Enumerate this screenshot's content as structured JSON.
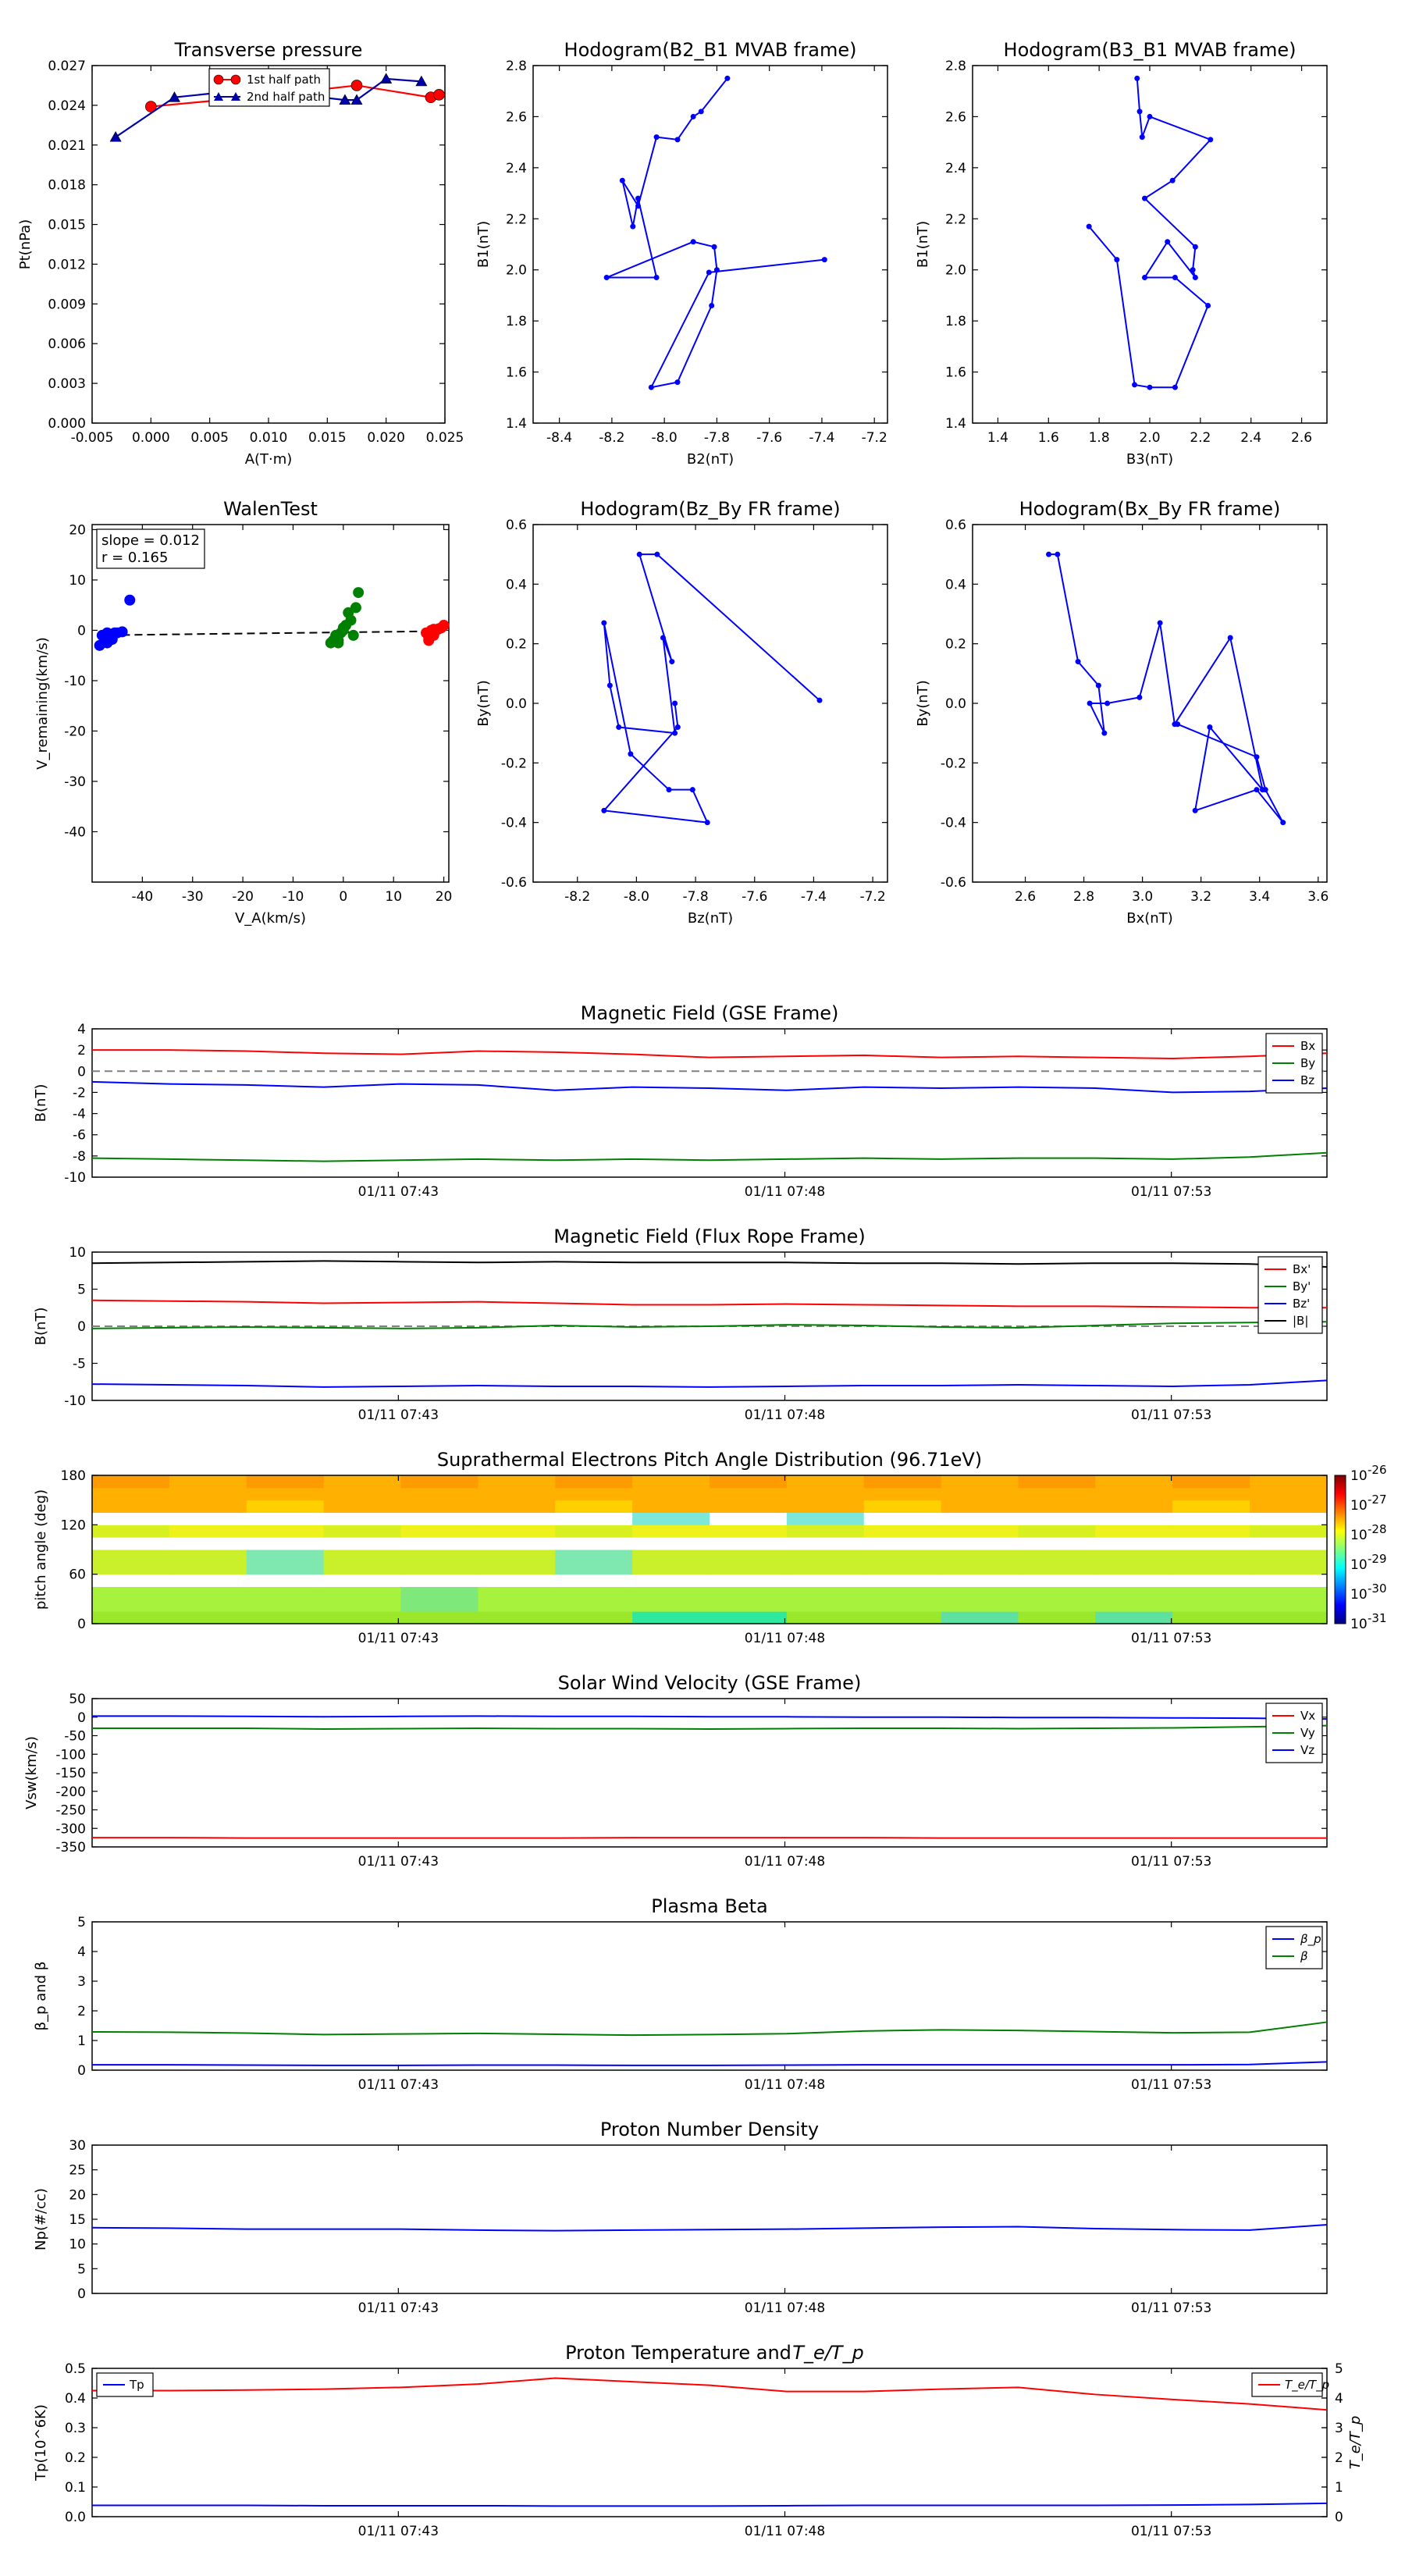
{
  "colors": {
    "red": "#ff0000",
    "green": "#008000",
    "blue": "#0000ff",
    "black": "#000000",
    "grey": "#808080"
  },
  "time_ticks": [
    "01/11 07:43",
    "01/11 07:48",
    "01/11 07:53"
  ],
  "chart_data": [
    {
      "id": "tp",
      "type": "line",
      "title": "Transverse pressure",
      "xlabel": "A(T·m)",
      "ylabel": "Pt(nPa)",
      "xlim": [
        -0.005,
        0.025
      ],
      "ylim": [
        0.0,
        0.027
      ],
      "xticks": [
        "-0.005",
        "0.000",
        "0.005",
        "0.010",
        "0.015",
        "0.020",
        "0.025"
      ],
      "yticks": [
        "0.000",
        "0.003",
        "0.006",
        "0.009",
        "0.012",
        "0.015",
        "0.018",
        "0.021",
        "0.024",
        "0.027"
      ],
      "legend": "top-center",
      "series": [
        {
          "name": "1st half path",
          "marker": "circle",
          "color": "#ff0000",
          "x": [
            0.0,
            0.0095,
            0.0175,
            0.0238,
            0.0245
          ],
          "y": [
            0.0239,
            0.0247,
            0.0255,
            0.0246,
            0.0248
          ]
        },
        {
          "name": "2nd half path",
          "marker": "triangle",
          "color": "#0000ab",
          "x": [
            -0.003,
            0.002,
            0.0085,
            0.0165,
            0.0175,
            0.02,
            0.023
          ],
          "y": [
            0.0216,
            0.0246,
            0.0252,
            0.0244,
            0.0244,
            0.026,
            0.0258
          ]
        }
      ]
    },
    {
      "id": "h21",
      "type": "line",
      "title": "Hodogram(B2_B1 MVAB frame)",
      "xlabel": "B2(nT)",
      "ylabel": "B1(nT)",
      "xlim": [
        -8.5,
        -7.15
      ],
      "ylim": [
        1.4,
        2.8
      ],
      "xticks": [
        "-8.4",
        "-8.2",
        "-8.0",
        "-7.8",
        "-7.6",
        "-7.4",
        "-7.2"
      ],
      "yticks": [
        "1.4",
        "1.6",
        "1.8",
        "2.0",
        "2.2",
        "2.4",
        "2.6",
        "2.8"
      ],
      "series": [
        {
          "name": "",
          "x": [
            -7.76,
            -7.86,
            -7.89,
            -7.95,
            -8.03,
            -8.1,
            -8.16,
            -8.12,
            -8.1,
            -8.03,
            -8.22,
            -7.89,
            -7.81,
            -7.8,
            -7.82,
            -7.95,
            -8.05,
            -7.83,
            -7.39
          ],
          "y": [
            2.75,
            2.62,
            2.6,
            2.51,
            2.52,
            2.25,
            2.35,
            2.17,
            2.28,
            1.97,
            1.97,
            2.11,
            2.09,
            2.0,
            1.86,
            1.56,
            1.54,
            1.99,
            2.04
          ]
        }
      ]
    },
    {
      "id": "h31",
      "type": "line",
      "title": "Hodogram(B3_B1 MVAB frame)",
      "xlabel": "B3(nT)",
      "ylabel": "B1(nT)",
      "xlim": [
        1.3,
        2.7
      ],
      "ylim": [
        1.4,
        2.8
      ],
      "xticks": [
        "1.4",
        "1.6",
        "1.8",
        "2.0",
        "2.2",
        "2.4",
        "2.6"
      ],
      "yticks": [
        "1.4",
        "1.6",
        "1.8",
        "2.0",
        "2.2",
        "2.4",
        "2.6",
        "2.8"
      ],
      "series": [
        {
          "name": "",
          "x": [
            1.95,
            1.96,
            1.97,
            2.0,
            2.24,
            2.09,
            1.98,
            2.18,
            2.17,
            2.18,
            2.07,
            1.98,
            2.1,
            2.23,
            2.1,
            2.0,
            1.94,
            1.87,
            1.76
          ],
          "y": [
            2.75,
            2.62,
            2.52,
            2.6,
            2.51,
            2.35,
            2.28,
            2.09,
            2.0,
            1.97,
            2.11,
            1.97,
            1.97,
            1.86,
            1.54,
            1.54,
            1.55,
            2.04,
            2.17
          ]
        }
      ]
    },
    {
      "id": "walen",
      "type": "scatter",
      "title": "WalenTest",
      "xlabel": "V_A(km/s)",
      "ylabel": "V_remaining(km/s)",
      "xlim": [
        -50,
        21
      ],
      "ylim": [
        -50,
        21
      ],
      "xticks": [
        "-40",
        "-30",
        "-20",
        "-10",
        "0",
        "10",
        "20"
      ],
      "yticks": [
        "-40",
        "-30",
        "-20",
        "-10",
        "0",
        "10",
        "20"
      ],
      "annotation": [
        "slope = 0.012",
        "r = 0.165"
      ],
      "fit": {
        "slope": 0.012,
        "intercept": -0.4,
        "x": [
          -49,
          20
        ]
      },
      "series": [
        {
          "name": "",
          "color": "#0000ff",
          "x": [
            -48,
            -47.5,
            -47,
            -46.5,
            -46,
            -45.5,
            -45,
            -44,
            -42.5,
            -48.5,
            -47,
            -46
          ],
          "y": [
            -1.0,
            -2.0,
            -0.5,
            -1.5,
            -0.8,
            -0.5,
            -0.5,
            -0.3,
            6.0,
            -3.0,
            -2.5,
            -1.8
          ]
        },
        {
          "name": "",
          "color": "#008000",
          "x": [
            -2.5,
            -2.0,
            -1.5,
            -1.0,
            -0.5,
            0.0,
            0.5,
            1.0,
            1.5,
            2.0,
            2.5,
            3.0,
            -1.0,
            0.0
          ],
          "y": [
            -2.5,
            -2.0,
            -1.0,
            -2.0,
            -0.5,
            0.5,
            1.0,
            3.5,
            2.0,
            -1.0,
            4.5,
            7.5,
            -2.5,
            0.0
          ]
        },
        {
          "name": "",
          "color": "#ff0000",
          "x": [
            16.5,
            17.0,
            17.5,
            18.0,
            18.5,
            19.0,
            19.5,
            20.0,
            17.0,
            18.0
          ],
          "y": [
            -0.5,
            -1.5,
            0.0,
            -1.0,
            0.0,
            0.3,
            0.5,
            1.0,
            -2.0,
            0.2
          ]
        }
      ]
    },
    {
      "id": "hzy",
      "type": "line",
      "title": "Hodogram(Bz_By FR frame)",
      "xlabel": "Bz(nT)",
      "ylabel": "By(nT)",
      "xlim": [
        -8.35,
        -7.15
      ],
      "ylim": [
        -0.6,
        0.6
      ],
      "xticks": [
        "-8.2",
        "-8.0",
        "-7.8",
        "-7.6",
        "-7.4",
        "-7.2"
      ],
      "yticks": [
        "-0.6",
        "-0.4",
        "-0.2",
        "0.0",
        "0.2",
        "0.4",
        "0.6"
      ],
      "series": [
        {
          "name": "",
          "x": [
            -7.38,
            -7.93,
            -7.99,
            -7.88,
            -7.91,
            -7.87,
            -8.06,
            -8.09,
            -8.11,
            -8.02,
            -7.89,
            -7.81,
            -7.76,
            -8.11,
            -7.86,
            -7.87
          ],
          "y": [
            0.01,
            0.5,
            0.5,
            0.14,
            0.22,
            -0.1,
            -0.08,
            0.06,
            0.27,
            -0.17,
            -0.29,
            -0.29,
            -0.4,
            -0.36,
            -0.08,
            0.0
          ]
        }
      ]
    },
    {
      "id": "hxy",
      "type": "line",
      "title": "Hodogram(Bx_By FR frame)",
      "xlabel": "Bx(nT)",
      "ylabel": "By(nT)",
      "xlim": [
        2.42,
        3.63
      ],
      "ylim": [
        -0.6,
        0.6
      ],
      "xticks": [
        "2.6",
        "2.8",
        "3.0",
        "3.2",
        "3.4",
        "3.6"
      ],
      "yticks": [
        "-0.6",
        "-0.4",
        "-0.2",
        "0.0",
        "0.2",
        "0.4",
        "0.6"
      ],
      "series": [
        {
          "name": "",
          "x": [
            2.68,
            2.71,
            2.78,
            2.85,
            2.87,
            2.82,
            2.88,
            2.99,
            3.06,
            3.11,
            3.3,
            3.41,
            3.23,
            3.18,
            3.39,
            3.48,
            3.42,
            3.39,
            3.12
          ],
          "y": [
            0.5,
            0.5,
            0.14,
            0.06,
            -0.1,
            0.0,
            0.0,
            0.02,
            0.27,
            -0.07,
            0.22,
            -0.29,
            -0.08,
            -0.36,
            -0.29,
            -0.4,
            -0.29,
            -0.18,
            -0.07
          ]
        }
      ]
    },
    {
      "id": "mag_gse",
      "type": "line",
      "title": "Magnetic Field (GSE Frame)",
      "ylabel": "B(nT)",
      "ylim": [
        -10,
        4
      ],
      "yticks": [
        "-10",
        "-8",
        "-6",
        "-4",
        "-2",
        "0",
        "2",
        "4"
      ],
      "legend": "top-right",
      "hline": 0,
      "series": [
        {
          "name": "Bx",
          "color": "#ff0000",
          "values": [
            2.0,
            2.0,
            1.9,
            1.7,
            1.6,
            1.9,
            1.8,
            1.6,
            1.3,
            1.4,
            1.5,
            1.3,
            1.4,
            1.3,
            1.2,
            1.4,
            1.7
          ]
        },
        {
          "name": "By",
          "color": "#008000",
          "values": [
            -8.2,
            -8.3,
            -8.4,
            -8.5,
            -8.4,
            -8.3,
            -8.4,
            -8.3,
            -8.4,
            -8.3,
            -8.2,
            -8.3,
            -8.2,
            -8.2,
            -8.3,
            -8.1,
            -7.7
          ]
        },
        {
          "name": "Bz",
          "color": "#0000ff",
          "values": [
            -1.0,
            -1.2,
            -1.3,
            -1.5,
            -1.2,
            -1.3,
            -1.8,
            -1.5,
            -1.6,
            -1.8,
            -1.5,
            -1.6,
            -1.5,
            -1.6,
            -2.0,
            -1.9,
            -1.6
          ]
        }
      ]
    },
    {
      "id": "mag_fr",
      "type": "line",
      "title": "Magnetic Field (Flux Rope Frame)",
      "ylabel": "B(nT)",
      "ylim": [
        -10,
        10
      ],
      "yticks": [
        "-10",
        "-5",
        "0",
        "5",
        "10"
      ],
      "legend": "top-right",
      "hline": 0,
      "series": [
        {
          "name": "Bx'",
          "color": "#ff0000",
          "values": [
            3.5,
            3.4,
            3.3,
            3.1,
            3.2,
            3.3,
            3.1,
            2.9,
            2.9,
            3.0,
            2.9,
            2.8,
            2.7,
            2.7,
            2.6,
            2.5,
            2.5
          ]
        },
        {
          "name": "By'",
          "color": "#008000",
          "values": [
            -0.3,
            -0.2,
            -0.1,
            -0.2,
            -0.3,
            -0.2,
            0.1,
            -0.1,
            0.0,
            0.2,
            0.1,
            -0.1,
            -0.2,
            0.1,
            0.4,
            0.5,
            0.6
          ]
        },
        {
          "name": "Bz'",
          "color": "#0000ff",
          "values": [
            -7.8,
            -7.9,
            -8.0,
            -8.2,
            -8.1,
            -8.0,
            -8.1,
            -8.1,
            -8.2,
            -8.1,
            -8.0,
            -8.0,
            -7.9,
            -8.0,
            -8.1,
            -7.9,
            -7.3
          ]
        },
        {
          "name": "|B|",
          "color": "#000000",
          "values": [
            8.5,
            8.6,
            8.7,
            8.8,
            8.7,
            8.6,
            8.7,
            8.6,
            8.6,
            8.6,
            8.5,
            8.5,
            8.4,
            8.5,
            8.5,
            8.4,
            8.0
          ]
        }
      ]
    },
    {
      "id": "pad",
      "type": "heatmap",
      "title": "Suprathermal Electrons Pitch Angle Distribution (96.71eV)",
      "ylabel": "pitch angle (deg)",
      "ylim": [
        0,
        180
      ],
      "yticks": [
        "0",
        "60",
        "120",
        "180"
      ],
      "colorbar": {
        "ticks": [
          "10",
          "10",
          "10",
          "10",
          "10",
          "10"
        ],
        "exponents": [
          "-26",
          "-27",
          "-28",
          "-29",
          "-30",
          "-31"
        ]
      },
      "bins": [
        {
          "angle": [
            0,
            15
          ],
          "level": "green"
        },
        {
          "angle": [
            15,
            45
          ],
          "level": "lightgreen"
        },
        {
          "angle": [
            45,
            60
          ],
          "level": "white"
        },
        {
          "angle": [
            60,
            90
          ],
          "level": "yellowgreen"
        },
        {
          "angle": [
            90,
            105
          ],
          "level": "white"
        },
        {
          "angle": [
            105,
            120
          ],
          "level": "yellow"
        },
        {
          "angle": [
            120,
            135
          ],
          "level": "white"
        },
        {
          "angle": [
            135,
            150
          ],
          "level": "orange"
        },
        {
          "angle": [
            150,
            165
          ],
          "level": "orange"
        },
        {
          "angle": [
            165,
            180
          ],
          "level": "orange"
        }
      ]
    },
    {
      "id": "vsw",
      "type": "line",
      "title": "Solar Wind Velocity (GSE Frame)",
      "ylabel": "Vsw(km/s)",
      "ylim": [
        -350,
        50
      ],
      "yticks": [
        "-350",
        "-300",
        "-250",
        "-200",
        "-150",
        "-100",
        "-50",
        "0",
        "50"
      ],
      "legend": "top-right",
      "series": [
        {
          "name": "Vx",
          "color": "#ff0000",
          "values": [
            -325,
            -325,
            -326,
            -326,
            -326,
            -326,
            -326,
            -325,
            -325,
            -325,
            -325,
            -326,
            -326,
            -326,
            -326,
            -326,
            -326
          ]
        },
        {
          "name": "Vy",
          "color": "#008000",
          "values": [
            -30,
            -30,
            -30,
            -32,
            -31,
            -30,
            -31,
            -31,
            -32,
            -31,
            -30,
            -30,
            -31,
            -30,
            -29,
            -26,
            -23
          ]
        },
        {
          "name": "Vz",
          "color": "#0000ff",
          "values": [
            3,
            3,
            2,
            1,
            2,
            3,
            2,
            2,
            1,
            1,
            0,
            0,
            -1,
            -1,
            -2,
            -3,
            -5
          ]
        }
      ]
    },
    {
      "id": "beta",
      "type": "line",
      "title": "Plasma Beta",
      "ylabel": "β_p and β",
      "ylim": [
        0,
        5
      ],
      "yticks": [
        "0",
        "1",
        "2",
        "3",
        "4",
        "5"
      ],
      "legend": "top-right",
      "series": [
        {
          "name": "β_p",
          "color": "#0000ff",
          "values": [
            0.18,
            0.18,
            0.17,
            0.16,
            0.16,
            0.17,
            0.17,
            0.16,
            0.16,
            0.17,
            0.18,
            0.18,
            0.18,
            0.18,
            0.18,
            0.19,
            0.28
          ]
        },
        {
          "name": "β",
          "color": "#008000",
          "values": [
            1.29,
            1.28,
            1.25,
            1.2,
            1.22,
            1.24,
            1.21,
            1.18,
            1.2,
            1.23,
            1.32,
            1.36,
            1.34,
            1.3,
            1.26,
            1.28,
            1.62
          ]
        }
      ]
    },
    {
      "id": "np",
      "type": "line",
      "title": "Proton Number Density",
      "ylabel": "Np(#/cc)",
      "ylim": [
        0,
        30
      ],
      "yticks": [
        "0",
        "5",
        "10",
        "15",
        "20",
        "25",
        "30"
      ],
      "series": [
        {
          "name": "",
          "color": "#0000ff",
          "values": [
            13.3,
            13.2,
            13.0,
            13.0,
            13.0,
            12.8,
            12.7,
            12.8,
            12.9,
            13.0,
            13.2,
            13.4,
            13.5,
            13.1,
            12.9,
            12.8,
            13.9
          ]
        }
      ]
    },
    {
      "id": "temp",
      "type": "line",
      "title": "Proton Temperature and",
      "title_math": "T_e/T_p",
      "ylabel": "Tp(10^6K)",
      "ylim": [
        0,
        0.5
      ],
      "yticks": [
        "0.0",
        "0.1",
        "0.2",
        "0.3",
        "0.4",
        "0.5"
      ],
      "ylabel2": "T_e/T_p",
      "ylim2": [
        0,
        5
      ],
      "yticks2": [
        "0",
        "1",
        "2",
        "3",
        "4",
        "5"
      ],
      "series": [
        {
          "name": "Tp",
          "color": "#0000ff",
          "axis": "left",
          "values": [
            0.038,
            0.038,
            0.038,
            0.037,
            0.037,
            0.037,
            0.036,
            0.036,
            0.036,
            0.037,
            0.038,
            0.038,
            0.038,
            0.038,
            0.039,
            0.041,
            0.045
          ]
        },
        {
          "name": "T_e/T_p",
          "color": "#ff0000",
          "axis": "right",
          "values": [
            4.25,
            4.25,
            4.27,
            4.3,
            4.36,
            4.47,
            4.67,
            4.55,
            4.43,
            4.22,
            4.22,
            4.3,
            4.36,
            4.12,
            3.95,
            3.8,
            3.6
          ]
        }
      ]
    }
  ]
}
